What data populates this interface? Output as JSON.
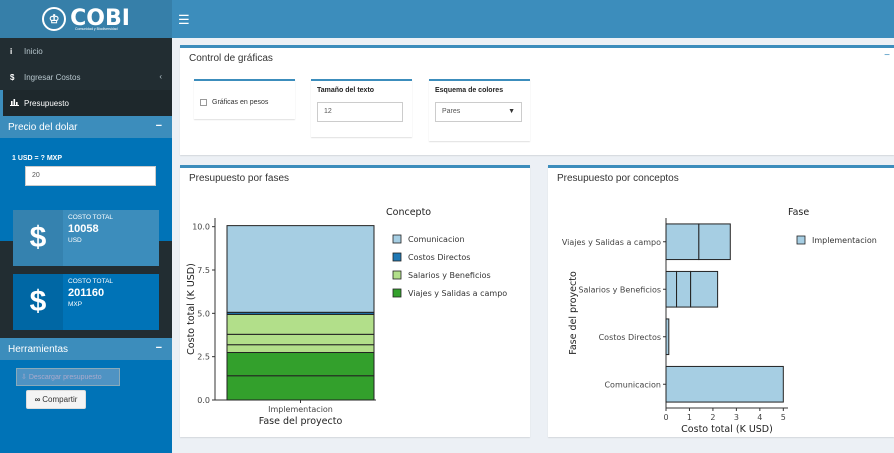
{
  "header": {
    "logo_text": "COBI",
    "logo_sub": "Comunidad y Biodiversidad",
    "menu_icon": "hamburger-icon"
  },
  "sidebar": {
    "items": [
      {
        "label": "Inicio",
        "icon": "info-icon"
      },
      {
        "label": "Ingresar Costos",
        "icon": "dollar-icon"
      },
      {
        "label": "Presupuesto",
        "icon": "bar-chart-icon"
      }
    ],
    "precio_title": "Precio del dolar",
    "rate_label": "1 USD = ? MXP",
    "rate_value": "20",
    "costo_usd": {
      "label": "COSTO TOTAL",
      "value": "10058",
      "unit": "USD"
    },
    "costo_mxp": {
      "label": "COSTO TOTAL",
      "value": "201160",
      "unit": "MXP"
    },
    "herramientas_title": "Herramientas",
    "descargar_label": "Descargar presupuesto",
    "compartir_label": "Compartir"
  },
  "control": {
    "title": "Control de gráficas",
    "checkbox_label": "Gráficas en pesos",
    "tamano_label": "Tamaño del texto",
    "tamano_value": "12",
    "esquema_label": "Esquema de colores",
    "esquema_value": "Pares"
  },
  "colors": {
    "header": "#3c8dbc",
    "sidebar": "#222d32",
    "box_blue": "#0073b7",
    "pal_light_blue": "#a6cee3",
    "pal_dark_blue": "#1f78b4",
    "pal_light_green": "#b2df8a",
    "pal_dark_green": "#33a02c"
  },
  "chart_data": [
    {
      "panel_title": "Presupuesto por fases",
      "type": "bar",
      "stacked": true,
      "categories": [
        "Implementacion"
      ],
      "xlabel": "Fase del proyecto",
      "ylabel": "Costo total (K USD)",
      "ylim": [
        0,
        10.5
      ],
      "yticks": [
        "0.0",
        "2.5",
        "5.0",
        "7.5",
        "10.0"
      ],
      "legend_title": "Concepto",
      "legend_position": "right",
      "series": [
        {
          "name": "Comunicacion",
          "color": "#a6cee3",
          "values": [
            5.0
          ]
        },
        {
          "name": "Costos Directos",
          "color": "#1f78b4",
          "values": [
            0.12
          ]
        },
        {
          "name": "Salarios y Beneficios",
          "color": "#b2df8a",
          "values": [
            2.2
          ]
        },
        {
          "name": "Viajes y Salidas a campo",
          "color": "#33a02c",
          "values": [
            2.74
          ]
        }
      ],
      "segments_bottom_to_top": [
        {
          "concept": "Viajes y Salidas a campo",
          "value": 1.4
        },
        {
          "concept": "Viajes y Salidas a campo",
          "value": 1.34
        },
        {
          "concept": "Salarios y Beneficios",
          "value": 0.45
        },
        {
          "concept": "Salarios y Beneficios",
          "value": 0.6
        },
        {
          "concept": "Salarios y Beneficios",
          "value": 1.15
        },
        {
          "concept": "Costos Directos",
          "value": 0.12
        },
        {
          "concept": "Comunicacion",
          "value": 5.0
        }
      ]
    },
    {
      "panel_title": "Presupuesto por conceptos",
      "type": "bar",
      "orientation": "horizontal",
      "categories": [
        "Comunicacion",
        "Costos Directos",
        "Salarios y Beneficios",
        "Viajes y Salidas a campo"
      ],
      "xlabel": "Costo total (K USD)",
      "ylabel": "Fase del proyecto",
      "xlim": [
        0,
        5.2
      ],
      "xticks": [
        "0",
        "1",
        "2",
        "3",
        "4",
        "5"
      ],
      "legend_title": "Fase",
      "legend_position": "right",
      "series": [
        {
          "name": "Implementacion",
          "color": "#a6cee3",
          "values": [
            5.0,
            0.12,
            2.2,
            2.74
          ]
        }
      ],
      "segments": [
        [
          5.0
        ],
        [
          0.12
        ],
        [
          0.45,
          0.6,
          1.15
        ],
        [
          1.4,
          1.34
        ]
      ]
    }
  ]
}
